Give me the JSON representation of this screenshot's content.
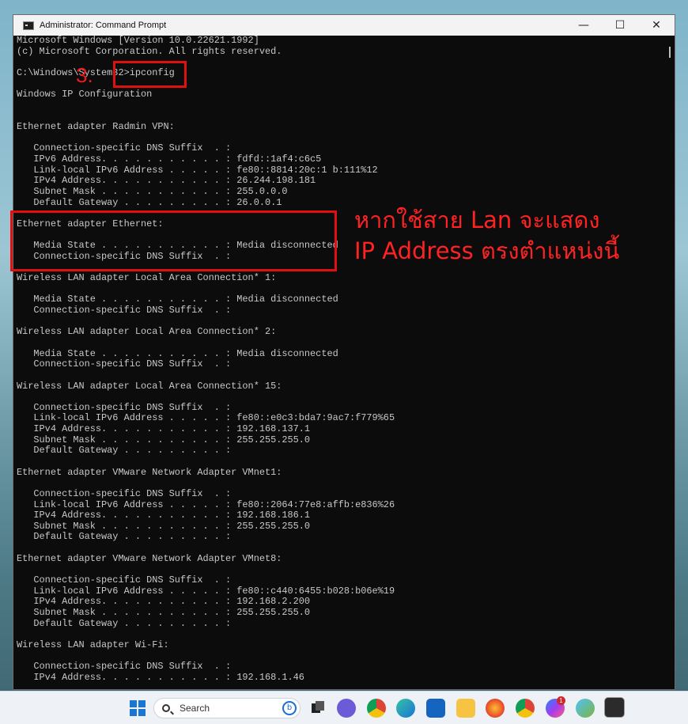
{
  "window": {
    "title": "Administrator: Command Prompt",
    "controls": {
      "minimize": "—",
      "maximize": "☐",
      "close": "✕"
    }
  },
  "console_lines": [
    "Microsoft Windows [Version 10.0.22621.1992]",
    "(c) Microsoft Corporation. All rights reserved.",
    "",
    "C:\\Windows\\System32>ipconfig",
    "",
    "Windows IP Configuration",
    "",
    "",
    "Ethernet adapter Radmin VPN:",
    "",
    "   Connection-specific DNS Suffix  . :",
    "   IPv6 Address. . . . . . . . . . . : fdfd::1af4:c6c5",
    "   Link-local IPv6 Address . . . . . : fe80::8814:20c:1 b:111%12",
    "   IPv4 Address. . . . . . . . . . . : 26.244.198.181",
    "   Subnet Mask . . . . . . . . . . . : 255.0.0.0",
    "   Default Gateway . . . . . . . . . : 26.0.0.1",
    "",
    "Ethernet adapter Ethernet:",
    "",
    "   Media State . . . . . . . . . . . : Media disconnected",
    "   Connection-specific DNS Suffix  . :",
    "",
    "Wireless LAN adapter Local Area Connection* 1:",
    "",
    "   Media State . . . . . . . . . . . : Media disconnected",
    "   Connection-specific DNS Suffix  . :",
    "",
    "Wireless LAN adapter Local Area Connection* 2:",
    "",
    "   Media State . . . . . . . . . . . : Media disconnected",
    "   Connection-specific DNS Suffix  . :",
    "",
    "Wireless LAN adapter Local Area Connection* 15:",
    "",
    "   Connection-specific DNS Suffix  . :",
    "   Link-local IPv6 Address . . . . . : fe80::e0c3:bda7:9ac7:f779%65",
    "   IPv4 Address. . . . . . . . . . . : 192.168.137.1",
    "   Subnet Mask . . . . . . . . . . . : 255.255.255.0",
    "   Default Gateway . . . . . . . . . :",
    "",
    "Ethernet adapter VMware Network Adapter VMnet1:",
    "",
    "   Connection-specific DNS Suffix  . :",
    "   Link-local IPv6 Address . . . . . : fe80::2064:77e8:affb:e836%26",
    "   IPv4 Address. . . . . . . . . . . : 192.168.186.1",
    "   Subnet Mask . . . . . . . . . . . : 255.255.255.0",
    "   Default Gateway . . . . . . . . . :",
    "",
    "Ethernet adapter VMware Network Adapter VMnet8:",
    "",
    "   Connection-specific DNS Suffix  . :",
    "   Link-local IPv6 Address . . . . . : fe80::c440:6455:b028:b06e%19",
    "   IPv4 Address. . . . . . . . . . . : 192.168.2.200",
    "   Subnet Mask . . . . . . . . . . . : 255.255.255.0",
    "   Default Gateway . . . . . . . . . :",
    "",
    "Wireless LAN adapter Wi-Fi:",
    "",
    "   Connection-specific DNS Suffix  . :",
    "   IPv4 Address. . . . . . . . . . . : 192.168.1.46"
  ],
  "annotations": {
    "step": "3.",
    "note_line1": "หากใช้สาย Lan จะแสดง",
    "note_line2": "IP Address ตรงตำแหน่งนี้"
  },
  "taskbar": {
    "search_placeholder": "Search",
    "messenger_badge": "1",
    "icons": [
      "windows-start-icon",
      "search-icon",
      "bing-icon",
      "task-view-icon",
      "chat-icon",
      "chrome-icon",
      "edge-icon",
      "mail-icon",
      "file-explorer-icon",
      "firefox-icon",
      "chrome-profile-icon",
      "messenger-icon",
      "photos-icon",
      "terminal-icon"
    ]
  }
}
